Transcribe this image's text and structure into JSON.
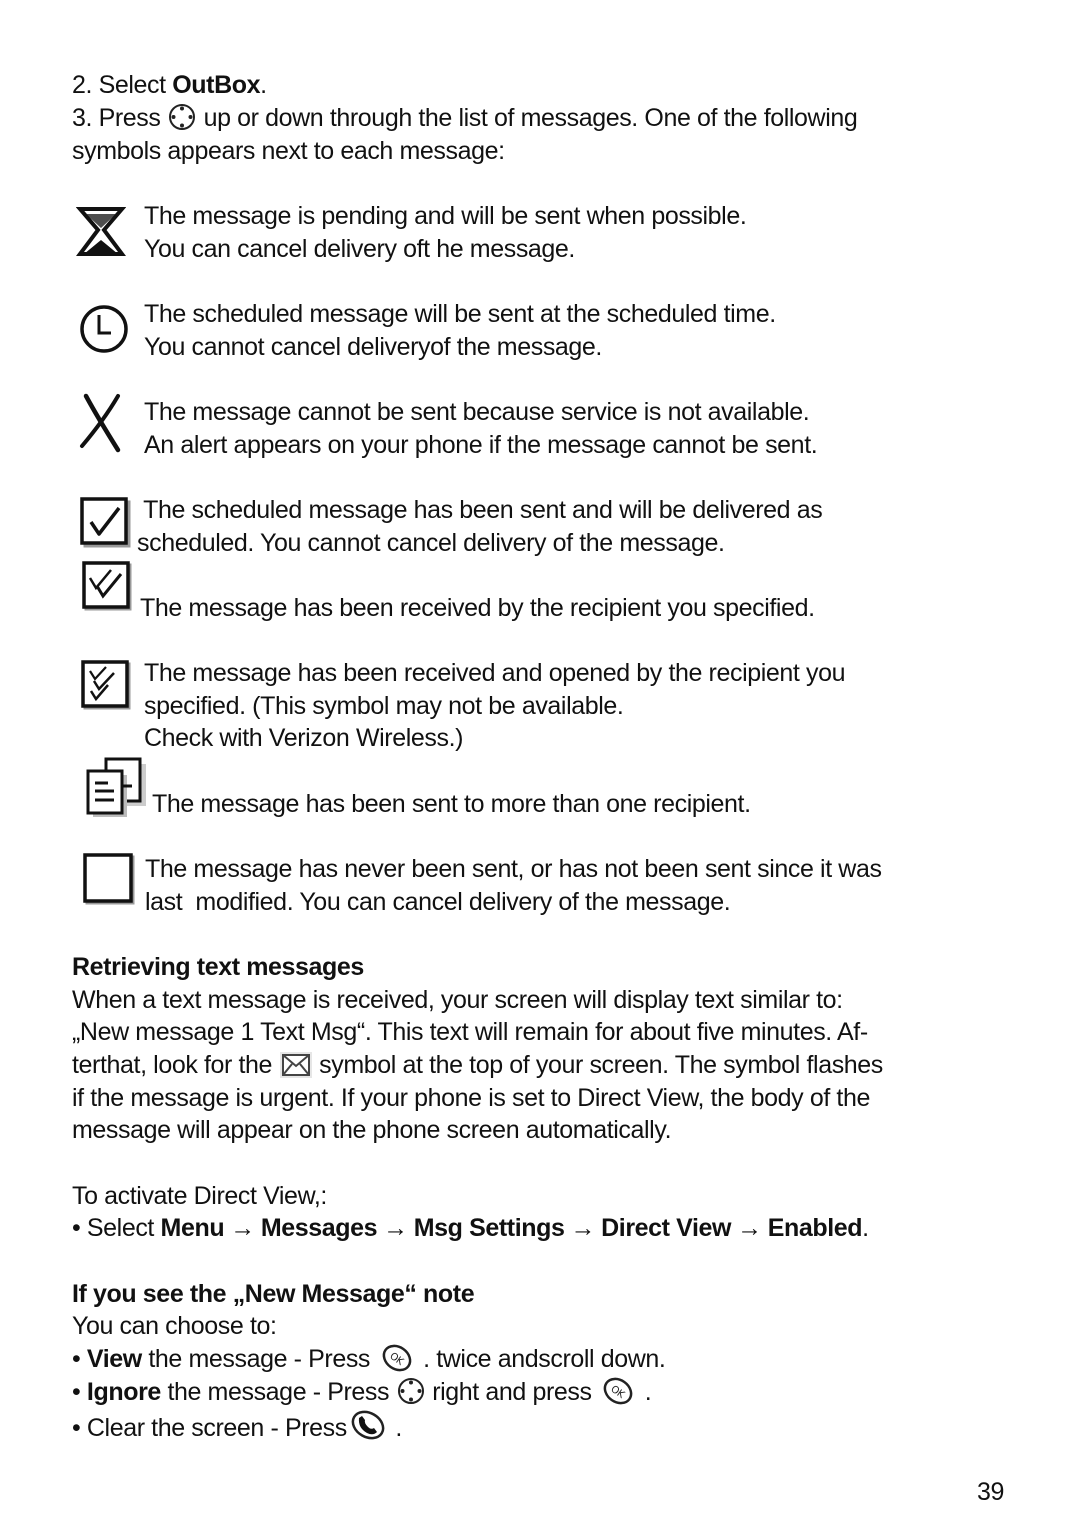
{
  "steps": {
    "step2_prefix": "2. Select ",
    "step2_bold": "OutBox",
    "step2_suffix": ".",
    "step3_prefix": "3. Press",
    "step3_suffix": "up or down through the list of messages. One of the following",
    "step3_line2": "symbols appears next to each message:"
  },
  "symbols": [
    {
      "icon": "hourglass-icon",
      "lines": [
        "The message is pending and will be sent when possible.",
        "You can cancel delivery oft he message."
      ]
    },
    {
      "icon": "clock-icon",
      "lines": [
        "The scheduled message will be sent at the scheduled time.",
        "You cannot cancel deliveryof the message."
      ]
    },
    {
      "icon": "x-mark-icon",
      "lines": [
        "The message cannot be sent because service is not available.",
        "An alert appears on your phone if the message cannot be sent."
      ]
    },
    {
      "icon": "checkbox-single-check-icon",
      "lines": [
        " The scheduled message has been sent and will be delivered as",
        "scheduled. You cannot cancel delivery of the message."
      ]
    },
    {
      "icon": "checkbox-double-check-icon",
      "lines": [
        "The message has been received by the recipient you specified."
      ]
    },
    {
      "icon": "checkbox-triple-check-icon",
      "lines": [
        "The message has been received and opened by the recipient you",
        "specified. (This symbol may not be available.",
        "Check with Verizon Wireless.)"
      ]
    },
    {
      "icon": "multiple-documents-icon",
      "lines": [
        "The message has been sent to more than one recipient."
      ]
    },
    {
      "icon": "empty-box-icon",
      "lines": [
        "The message has never been sent, or has not been sent since it was",
        "last  modified. You can cancel delivery of the message."
      ]
    }
  ],
  "retrieving": {
    "heading": "Retrieving text messages",
    "line1": "When a text message is received, your screen will display text similar to:",
    "line2": "„New message 1 Text Msg“. This text will remain for about five minutes. Af-",
    "line3_prefix": "terthat, look for the",
    "line3_suffix": "symbol at the top of your screen. The symbol flashes",
    "line4": "if the message is urgent. If your phone is set to Direct View, the body of the",
    "line5": "message will appear on the phone screen automatically."
  },
  "direct_view": {
    "intro": "To activate Direct View,:",
    "bullet_prefix": "• Select ",
    "path": [
      "Menu",
      "Messages",
      "Msg Settings",
      "Direct View",
      "Enabled"
    ],
    "arrow": "→",
    "suffix": "."
  },
  "new_message_note": {
    "heading": "If you see the „New Message“ note",
    "intro": "You can choose to:",
    "view_bullet": "• ",
    "view_bold": "View",
    "view_text": " the message - Press",
    "view_suffix": ". twice andscroll down.",
    "ignore_bullet": "• ",
    "ignore_bold": "Ignore",
    "ignore_text": " the message - Press",
    "ignore_mid": "right and press",
    "ignore_suffix": ".",
    "clear_text": "• Clear the screen - Press",
    "clear_suffix": "."
  },
  "page_number": "39"
}
